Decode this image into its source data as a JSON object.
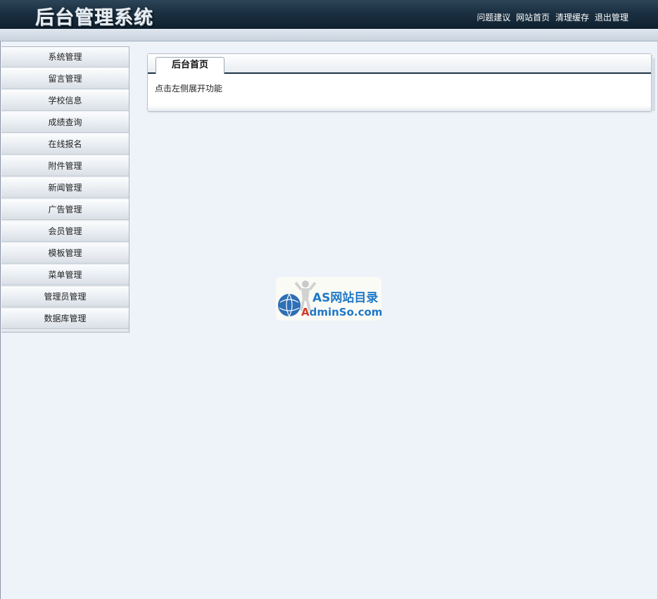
{
  "header": {
    "title": "后台管理系统",
    "links": [
      "问题建议",
      "网站首页",
      "清理缓存",
      "退出管理"
    ]
  },
  "sidebar": {
    "items": [
      {
        "label": "系统管理"
      },
      {
        "label": "留言管理"
      },
      {
        "label": "学校信息"
      },
      {
        "label": "成绩查询"
      },
      {
        "label": "在线报名"
      },
      {
        "label": "附件管理"
      },
      {
        "label": "新闻管理"
      },
      {
        "label": "广告管理"
      },
      {
        "label": "会员管理"
      },
      {
        "label": "模板管理"
      },
      {
        "label": "菜单管理"
      },
      {
        "label": "管理员管理"
      },
      {
        "label": "数据库管理"
      }
    ]
  },
  "main": {
    "tab_label": "后台首页",
    "message": "点击左侧展开功能"
  },
  "watermark": {
    "line1": "AS网站目录",
    "line2_first": "A",
    "line2_rest": "dminSo.com"
  },
  "colors": {
    "header_dark": "#1b3042",
    "background": "#eef2f9",
    "watermark_blue": "#1f78c8",
    "watermark_red": "#d33a2a"
  },
  "icons": {
    "watermark": "globe-person-logo"
  }
}
